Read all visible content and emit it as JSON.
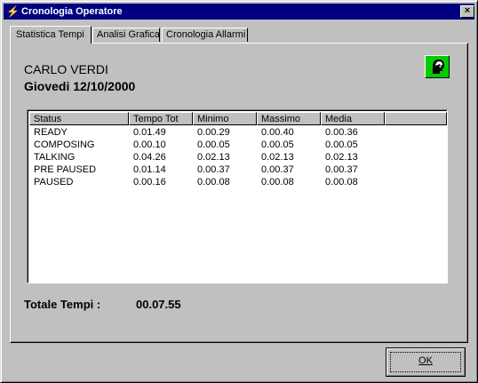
{
  "window": {
    "title": "Cronologia Operatore",
    "close_label": "×"
  },
  "tabs": [
    {
      "label": "Statistica Tempi"
    },
    {
      "label": "Analisi Grafica"
    },
    {
      "label": "Cronologia Allarmi"
    }
  ],
  "operator": {
    "name": "CARLO VERDI",
    "date": "Giovedi 12/10/2000"
  },
  "table": {
    "columns": [
      "Status",
      "Tempo Tot",
      "Minimo",
      "Massimo",
      "Media"
    ],
    "rows": [
      [
        "READY",
        "0.01.49",
        "0.00.29",
        "0.00.40",
        "0.00.36"
      ],
      [
        "COMPOSING",
        "0.00.10",
        "0.00.05",
        "0.00.05",
        "0.00.05"
      ],
      [
        "TALKING",
        "0.04.26",
        "0.02.13",
        "0.02.13",
        "0.02.13"
      ],
      [
        "PRE PAUSED",
        "0.01.14",
        "0.00.37",
        "0.00.37",
        "0.00.37"
      ],
      [
        "PAUSED",
        "0.00.16",
        "0.00.08",
        "0.00.08",
        "0.00.08"
      ]
    ]
  },
  "total": {
    "label": "Totale Tempi :",
    "value": "00.07.55"
  },
  "buttons": {
    "ok": "OK"
  },
  "colors": {
    "titlebar": "#000080",
    "agent_icon_bg": "#00cc00"
  }
}
